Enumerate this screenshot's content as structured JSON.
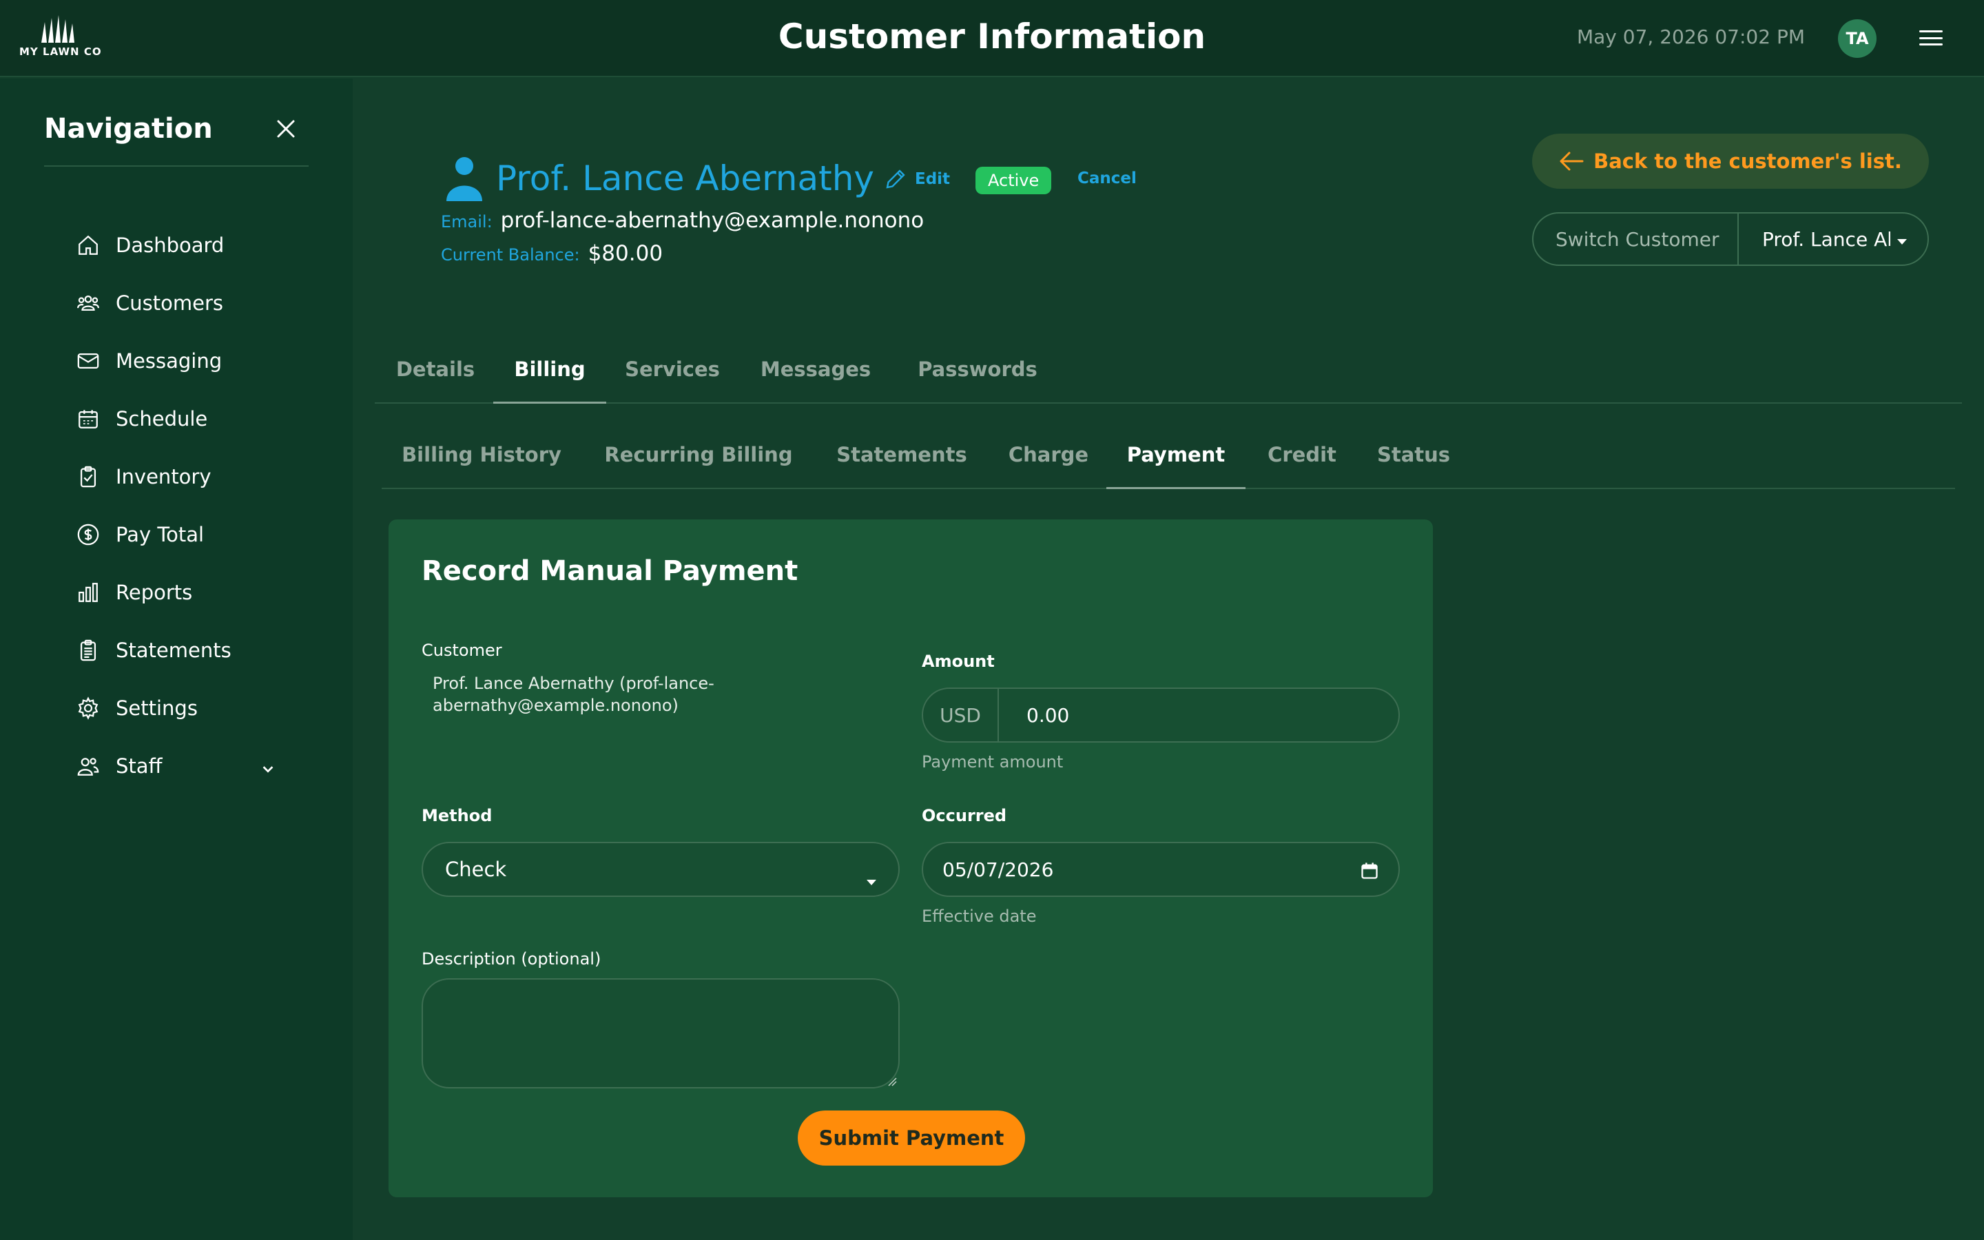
{
  "header": {
    "logo_text": "MY LAWN CO",
    "title": "Customer Information",
    "datetime": "May 07, 2026 07:02 PM",
    "avatar_initials": "TA"
  },
  "sidebar": {
    "title": "Navigation",
    "items": [
      {
        "label": "Dashboard",
        "icon": "home-icon"
      },
      {
        "label": "Customers",
        "icon": "users-icon"
      },
      {
        "label": "Messaging",
        "icon": "envelope-icon"
      },
      {
        "label": "Schedule",
        "icon": "calendar-icon"
      },
      {
        "label": "Inventory",
        "icon": "clipboard-check-icon"
      },
      {
        "label": "Pay Total",
        "icon": "dollar-circle-icon"
      },
      {
        "label": "Reports",
        "icon": "bar-chart-icon"
      },
      {
        "label": "Statements",
        "icon": "documents-icon"
      },
      {
        "label": "Settings",
        "icon": "gear-icon"
      },
      {
        "label": "Staff",
        "icon": "staff-icon",
        "has_submenu": true
      }
    ]
  },
  "customer": {
    "name": "Prof. Lance Abernathy",
    "edit_label": "Edit",
    "status": "Active",
    "cancel_label": "Cancel",
    "email_label": "Email:",
    "email": "prof-lance-abernathy@example.nonono",
    "balance_label": "Current Balance:",
    "balance": "$80.00"
  },
  "actions": {
    "back_label": "Back to the customer's list.",
    "switch_label": "Switch Customer",
    "switch_value": "Prof. Lance Abernathy"
  },
  "tabs": [
    {
      "label": "Details",
      "active": false
    },
    {
      "label": "Billing",
      "active": true
    },
    {
      "label": "Services",
      "active": false
    },
    {
      "label": "Messages",
      "active": false
    },
    {
      "label": "Passwords",
      "active": false
    }
  ],
  "subtabs": [
    {
      "label": "Billing History",
      "active": false
    },
    {
      "label": "Recurring Billing",
      "active": false
    },
    {
      "label": "Statements",
      "active": false
    },
    {
      "label": "Charge",
      "active": false
    },
    {
      "label": "Payment",
      "active": true
    },
    {
      "label": "Credit",
      "active": false
    },
    {
      "label": "Status",
      "active": false
    }
  ],
  "payment_form": {
    "title": "Record Manual Payment",
    "customer_label": "Customer",
    "customer_value": "Prof. Lance Abernathy (prof-lance-abernathy@example.nonono)",
    "amount_label": "Amount",
    "currency": "USD",
    "amount_value": "0.00",
    "amount_hint": "Payment amount",
    "method_label": "Method",
    "method_value": "Check",
    "occurred_label": "Occurred",
    "occurred_value": "05/07/2026",
    "occurred_hint": "Effective date",
    "description_label": "Description (optional)",
    "description_value": "",
    "submit_label": "Submit Payment"
  },
  "colors": {
    "accent_blue": "#20a6df",
    "accent_orange": "#ff8c0a",
    "active_green": "#25c25e",
    "background": "#133f2b"
  }
}
